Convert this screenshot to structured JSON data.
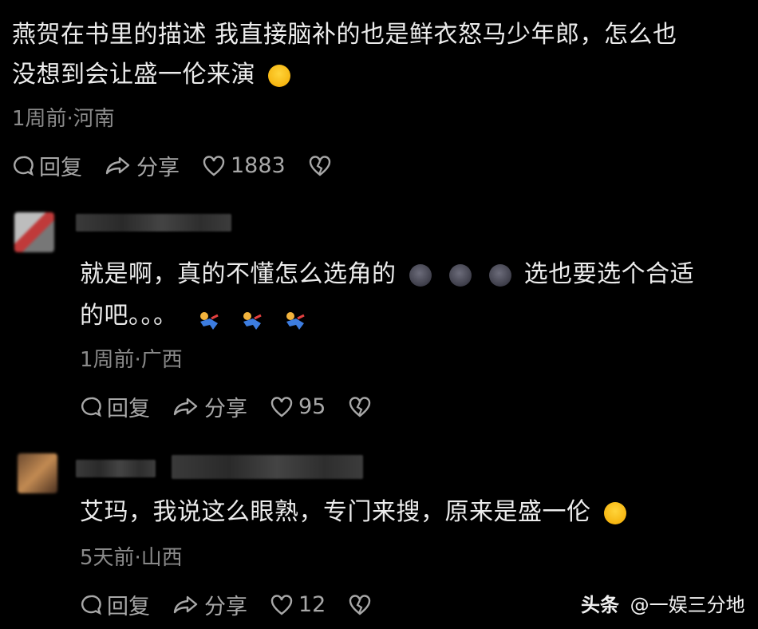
{
  "comments": [
    {
      "text_line1": "燕贺在书里的描述 我直接脑补的也是鲜衣怒马少年郎，怎么也",
      "text_line2": "没想到会让盛一伦来演",
      "emoji_tail": "🤣",
      "meta": "1周前·河南",
      "reply": "回复",
      "share": "分享",
      "likes": "1883"
    },
    {
      "text_line1": "就是啊，真的不懂怎么选角的",
      "text_line1b": "选也要选个合适",
      "text_line2": "的吧。。。",
      "meta": "1周前·广西",
      "reply": "回复",
      "share": "分享",
      "likes": "95"
    },
    {
      "text_line1": "艾玛，我说这么眼熟，专门来搜，原来是盛一伦",
      "meta": "5天前·山西",
      "reply": "回复",
      "share": "分享",
      "likes": "12"
    }
  ],
  "watermark": {
    "brand": "头条",
    "account": "@一娱三分地"
  },
  "colors": {
    "background": "#000000",
    "text": "#ececec",
    "meta": "#8a8a8a"
  }
}
